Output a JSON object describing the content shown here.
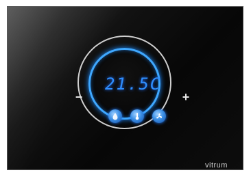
{
  "display": {
    "temperature": "21.5C"
  },
  "controls": {
    "minus_label": "−",
    "plus_label": "+"
  },
  "mode_buttons": [
    {
      "icon": "water-drop-icon"
    },
    {
      "icon": "thermometer-icon"
    },
    {
      "icon": "fan-icon"
    }
  ],
  "brand": {
    "logo_text": "vitrum"
  },
  "colors": {
    "accent": "#3fa8ff",
    "panel": "#0a0a0a",
    "ring": "#cfcfcf"
  }
}
